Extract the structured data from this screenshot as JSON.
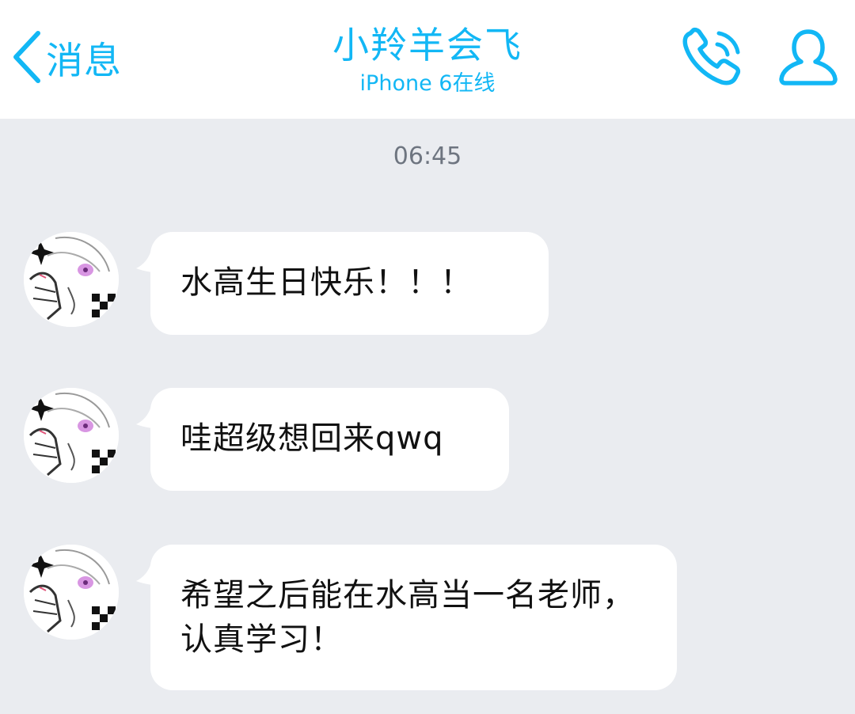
{
  "header": {
    "back_label": "消息",
    "title": "小羚羊会飞",
    "subtitle": "iPhone 6在线",
    "icons": [
      "chevron-left-icon",
      "phone-icon",
      "user-icon"
    ]
  },
  "colors": {
    "accent": "#12b7f5",
    "chat_background": "#eaecf0",
    "bubble": "#ffffff",
    "timestamp": "#6e7580"
  },
  "chat": {
    "timestamp": "06:45",
    "messages": [
      {
        "text": "水高生日快乐！！！"
      },
      {
        "text": "哇超级想回来qwq"
      },
      {
        "text": "希望之后能在水高当一名老师，认真学习！"
      }
    ]
  }
}
